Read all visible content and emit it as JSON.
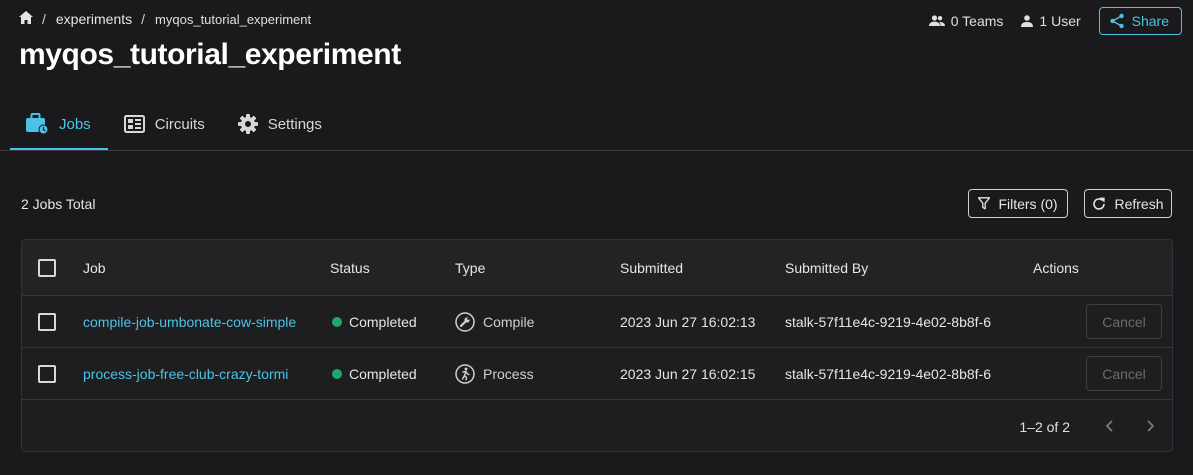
{
  "breadcrumb": {
    "home_icon": "home-icon",
    "separator": "/",
    "items": [
      "experiments",
      "myqos_tutorial_experiment"
    ]
  },
  "page": {
    "title": "myqos_tutorial_experiment"
  },
  "header": {
    "teams_label": "0 Teams",
    "users_label": "1 User",
    "share_label": "Share"
  },
  "tabs": [
    {
      "label": "Jobs",
      "icon": "jobs-briefcase-icon",
      "active": true
    },
    {
      "label": "Circuits",
      "icon": "circuits-icon",
      "active": false
    },
    {
      "label": "Settings",
      "icon": "gear-icon",
      "active": false
    }
  ],
  "toolbar": {
    "total_label": "2 Jobs Total",
    "filters_label": "Filters (0)",
    "refresh_label": "Refresh"
  },
  "table": {
    "columns": [
      "Job",
      "Status",
      "Type",
      "Submitted",
      "Submitted By",
      "Actions"
    ],
    "rows": [
      {
        "job": "compile-job-umbonate-cow-simple",
        "status": "Completed",
        "type": "Compile",
        "type_icon": "wrench-icon",
        "submitted": "2023 Jun 27 16:02:13",
        "submitted_by": "stalk-57f11e4c-9219-4e02-8b8f-6",
        "action": "Cancel"
      },
      {
        "job": "process-job-free-club-crazy-tormi",
        "status": "Completed",
        "type": "Process",
        "type_icon": "runner-icon",
        "submitted": "2023 Jun 27 16:02:15",
        "submitted_by": "stalk-57f11e4c-9219-4e02-8b8f-6",
        "action": "Cancel"
      }
    ],
    "pagination": "1–2 of 2"
  },
  "colors": {
    "accent": "#4cc3e6",
    "status_completed": "#21a66b",
    "background": "#1a191b"
  }
}
